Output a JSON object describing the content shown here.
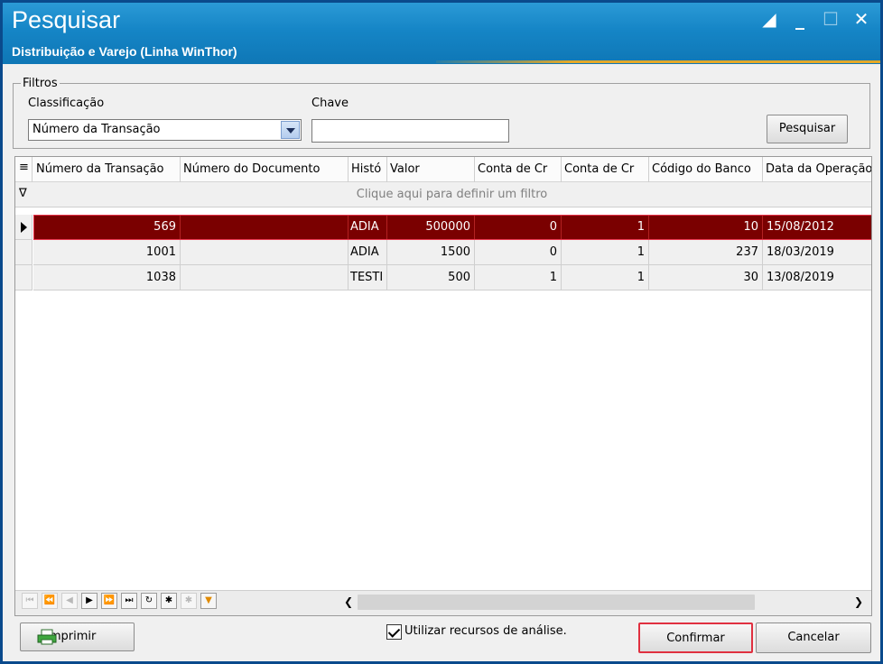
{
  "window": {
    "title": "Pesquisar",
    "subtitle": "Distribuição e Varejo (Linha WinThor)"
  },
  "filters": {
    "legend": "Filtros",
    "classification_label": "Classificação",
    "classification_value": "Número da Transação",
    "key_label": "Chave",
    "key_value": "",
    "search_button": "Pesquisar"
  },
  "grid": {
    "columns": [
      "Número da Transação",
      "Número do Documento",
      "Histó",
      "Valor",
      "Conta de Cr",
      "Conta de Cr",
      "Código do Banco",
      "Data da Operação"
    ],
    "filter_hint": "Clique aqui para definir um filtro",
    "rows": [
      [
        "569",
        "",
        "ADIA",
        "500000",
        "0",
        "1",
        "10",
        "15/08/2012"
      ],
      [
        "1001",
        "",
        "ADIA",
        "1500",
        "0",
        "1",
        "237",
        "18/03/2019"
      ],
      [
        "1038",
        "",
        "TESTI",
        "500",
        "1",
        "1",
        "30",
        "13/08/2019"
      ]
    ],
    "selected_row": 0
  },
  "footer": {
    "print_button": "Imprimir",
    "analysis_checkbox": "Utilizar recursos de análise.",
    "analysis_checked": true,
    "confirm_button": "Confirmar",
    "cancel_button": "Cancelar"
  },
  "colors": {
    "titlebar": "#1585c6",
    "selected_row": "#7a0000",
    "highlight_outline": "#e03040"
  }
}
